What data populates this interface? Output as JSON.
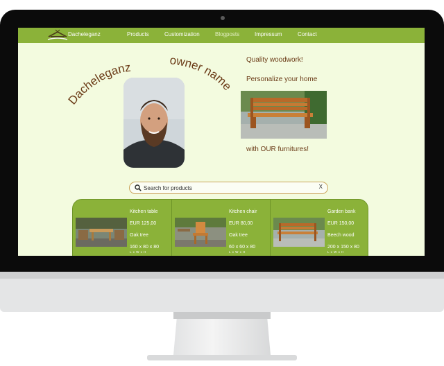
{
  "nav": {
    "brand": "Dacheleganz",
    "items": [
      {
        "label": "Products"
      },
      {
        "label": "Customization"
      },
      {
        "label": "Blogposts"
      },
      {
        "label": "Impressum"
      },
      {
        "label": "Contact"
      }
    ],
    "active_item": "Blogposts"
  },
  "hero": {
    "curved_left": "Dacheleganz",
    "curved_right": "owner name",
    "tagline_1": "Quality woodwork!",
    "tagline_2": "Personalize your home",
    "tagline_3": "with OUR furnitures!"
  },
  "search": {
    "placeholder": "Search for products",
    "clear_label": "X"
  },
  "products": [
    {
      "name": "Kitchen table",
      "price": "EUR 125,00",
      "material": "Oak tree",
      "dimensions": "160 x 80 x 80",
      "dimension_key": "L x W x H",
      "image_icon": "table-with-chairs"
    },
    {
      "name": "Kitchen chair",
      "price": "EUR 80,00",
      "material": "Oak tree",
      "dimensions": "60 x 60 x 80",
      "dimension_key": "L x W x H",
      "image_icon": "wooden-chair"
    },
    {
      "name": "Garden bank",
      "price": "EUR 150,00",
      "material": "Beech wood",
      "dimensions": "200 x 150 x 80",
      "dimension_key": "L x W x H",
      "image_icon": "garden-bench"
    }
  ],
  "colors": {
    "nav_green": "#8bb239",
    "page_background": "#f3fbdf",
    "brown_text": "#6a3a16"
  }
}
